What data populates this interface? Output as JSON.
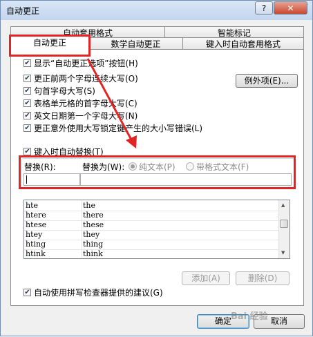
{
  "window": {
    "title": "自动更正",
    "help_label": "?",
    "close_label": "✕"
  },
  "tabs": {
    "autoformat": "自动套用格式",
    "smarttags": "智能标记",
    "autocorrect": "自动更正",
    "math": "数学自动更正",
    "autoformat_typing": "键入时自动套用格式"
  },
  "checkboxes": [
    {
      "label": "显示“自动更正选项”按钮(H)",
      "checked": "✔"
    },
    {
      "label": "更正前两个字母连续大写(O)",
      "checked": "✔"
    },
    {
      "label": "句首字母大写(S)",
      "checked": "✔"
    },
    {
      "label": "表格单元格的首字母大写(C)",
      "checked": "✔"
    },
    {
      "label": "英文日期第一个字母大写(N)",
      "checked": "✔"
    },
    {
      "label": "更正意外使用大写锁定键产生的大小写错误(L)",
      "checked": "✔"
    }
  ],
  "exceptions_button": "例外项(E)...",
  "replace_as_type": {
    "label": "键入时自动替换(T)",
    "checked": "✔"
  },
  "replace_group": {
    "replace_label": "替换(R):",
    "with_label": "替换为(W):",
    "plain_text": "纯文本(P)",
    "formatted_text": "带格式文本(F)"
  },
  "list": {
    "rows": [
      {
        "from": "hte",
        "to": "the"
      },
      {
        "from": "htere",
        "to": "there"
      },
      {
        "from": "htese",
        "to": "these"
      },
      {
        "from": "htey",
        "to": "they"
      },
      {
        "from": "hting",
        "to": "thing"
      },
      {
        "from": "htink",
        "to": "think"
      }
    ]
  },
  "add_button": "添加(A)",
  "delete_button": "删除(D)",
  "spellcheck": {
    "label": "自动使用拼写检查器提供的建议(G)",
    "checked": "✔"
  },
  "ok_button": "确定",
  "cancel_button": "取消",
  "watermark": "Bai 经验",
  "colors": {
    "highlight": "#e32424",
    "title_bg": "#c3d5ee",
    "close_bg": "#c9472f"
  }
}
